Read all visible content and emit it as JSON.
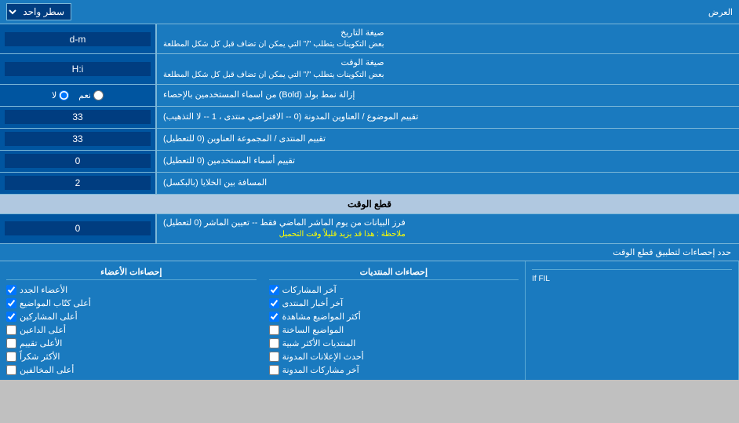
{
  "header": {
    "display_label": "العرض",
    "display_select_default": "سطر واحد"
  },
  "rows": [
    {
      "id": "date_format",
      "label": "صيغة التاريخ",
      "sublabel": "بعض التكوينات يتطلب \"/\" التي يمكن ان تضاف قبل كل شكل المطلعة",
      "value": "d-m",
      "type": "text"
    },
    {
      "id": "time_format",
      "label": "صيغة الوقت",
      "sublabel": "بعض التكوينات يتطلب \"/\" التي يمكن ان تضاف قبل كل شكل المطلعة",
      "value": "H:i",
      "type": "text"
    },
    {
      "id": "bold_remove",
      "label": "إزالة نمط بولد (Bold) من اسماء المستخدمين بالإحصاء",
      "type": "radio",
      "radio_yes": "نعم",
      "radio_no": "لا",
      "selected": "no"
    },
    {
      "id": "forum_sort",
      "label": "تقييم الموضوع / العناوين المدونة (0 -- الافتراضي منتدى ، 1 -- لا التذهيب)",
      "value": "33",
      "type": "text"
    },
    {
      "id": "forum_group_sort",
      "label": "تقييم المنتدى / المجموعة العناوين (0 للتعطيل)",
      "value": "33",
      "type": "text"
    },
    {
      "id": "users_sort",
      "label": "تقييم أسماء المستخدمين (0 للتعطيل)",
      "value": "0",
      "type": "text"
    },
    {
      "id": "cell_distance",
      "label": "المسافة بين الخلايا (بالبكسل)",
      "value": "2",
      "type": "text"
    }
  ],
  "time_cut_section": {
    "header": "قطع الوقت",
    "row": {
      "label": "فرز البيانات من يوم الماشر الماضي فقط -- تعيين الماشر (0 لتعطيل)",
      "note": "ملاحظة : هذا قد يزيد قليلاً وقت التحميل",
      "value": "0",
      "type": "text"
    },
    "apply_label": "حدد إحصاءات لتطبيق قطع الوقت"
  },
  "stats_sections": [
    {
      "header": "",
      "items": []
    },
    {
      "header": "إحصاءات المنتديات",
      "items": [
        {
          "label": "آخر المشاركات",
          "checked": true
        },
        {
          "label": "آخر أخبار المنتدى",
          "checked": true
        },
        {
          "label": "أكثر المواضيع مشاهدة",
          "checked": true
        },
        {
          "label": "المواضيع الساخنة",
          "checked": false
        },
        {
          "label": "المنتديات الأكثر شبية",
          "checked": false
        },
        {
          "label": "أحدث الإعلانات المدونة",
          "checked": false
        },
        {
          "label": "آخر مشاركات المدونة",
          "checked": false
        }
      ]
    },
    {
      "header": "إحصاءات الأعضاء",
      "items": [
        {
          "label": "الأعضاء الجدد",
          "checked": true
        },
        {
          "label": "أعلى كتّاب المواضيع",
          "checked": true
        },
        {
          "label": "أعلى المشاركين",
          "checked": true
        },
        {
          "label": "أعلى الداعين",
          "checked": false
        },
        {
          "label": "الأعلى تقييم",
          "checked": false
        },
        {
          "label": "الأكثر شكراً",
          "checked": false
        },
        {
          "label": "أعلى المخالفين",
          "checked": false
        }
      ]
    }
  ],
  "if_fil_text": "If FIL"
}
